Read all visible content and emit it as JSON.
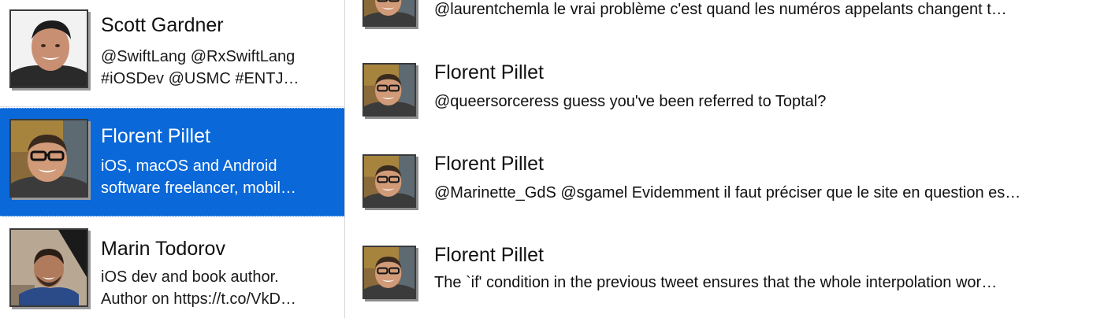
{
  "users": [
    {
      "name": "Scott Gardner",
      "bio_line1": "@SwiftLang @RxSwiftLang",
      "bio_line2": "#iOSDev @USMC #ENTJ…",
      "avatar": "scott-gardner-photo",
      "selected": false
    },
    {
      "name": "Florent Pillet",
      "bio_line1": "iOS, macOS and Android",
      "bio_line2": "software freelancer, mobil…",
      "avatar": "florent-pillet-photo",
      "selected": true
    },
    {
      "name": "Marin Todorov",
      "bio_line1": "iOS dev and book author.",
      "bio_line2": "Author on https://t.co/VkD…",
      "avatar": "marin-todorov-photo",
      "selected": false
    }
  ],
  "tweets": [
    {
      "author": "",
      "text": "@laurentchemla le vrai problème c'est quand les numéros appelants changent t…"
    },
    {
      "author": "Florent Pillet",
      "text": "@queersorceress guess you've been referred to Toptal?"
    },
    {
      "author": "Florent Pillet",
      "text": "@Marinette_GdS @sgamel Evidemment il faut préciser que le site en question es…"
    },
    {
      "author": "Florent Pillet",
      "text": "The `if' condition in the previous tweet ensures that the whole interpolation wor…"
    }
  ],
  "colors": {
    "selection": "#0a68d8",
    "divider": "#d6d6d6"
  }
}
